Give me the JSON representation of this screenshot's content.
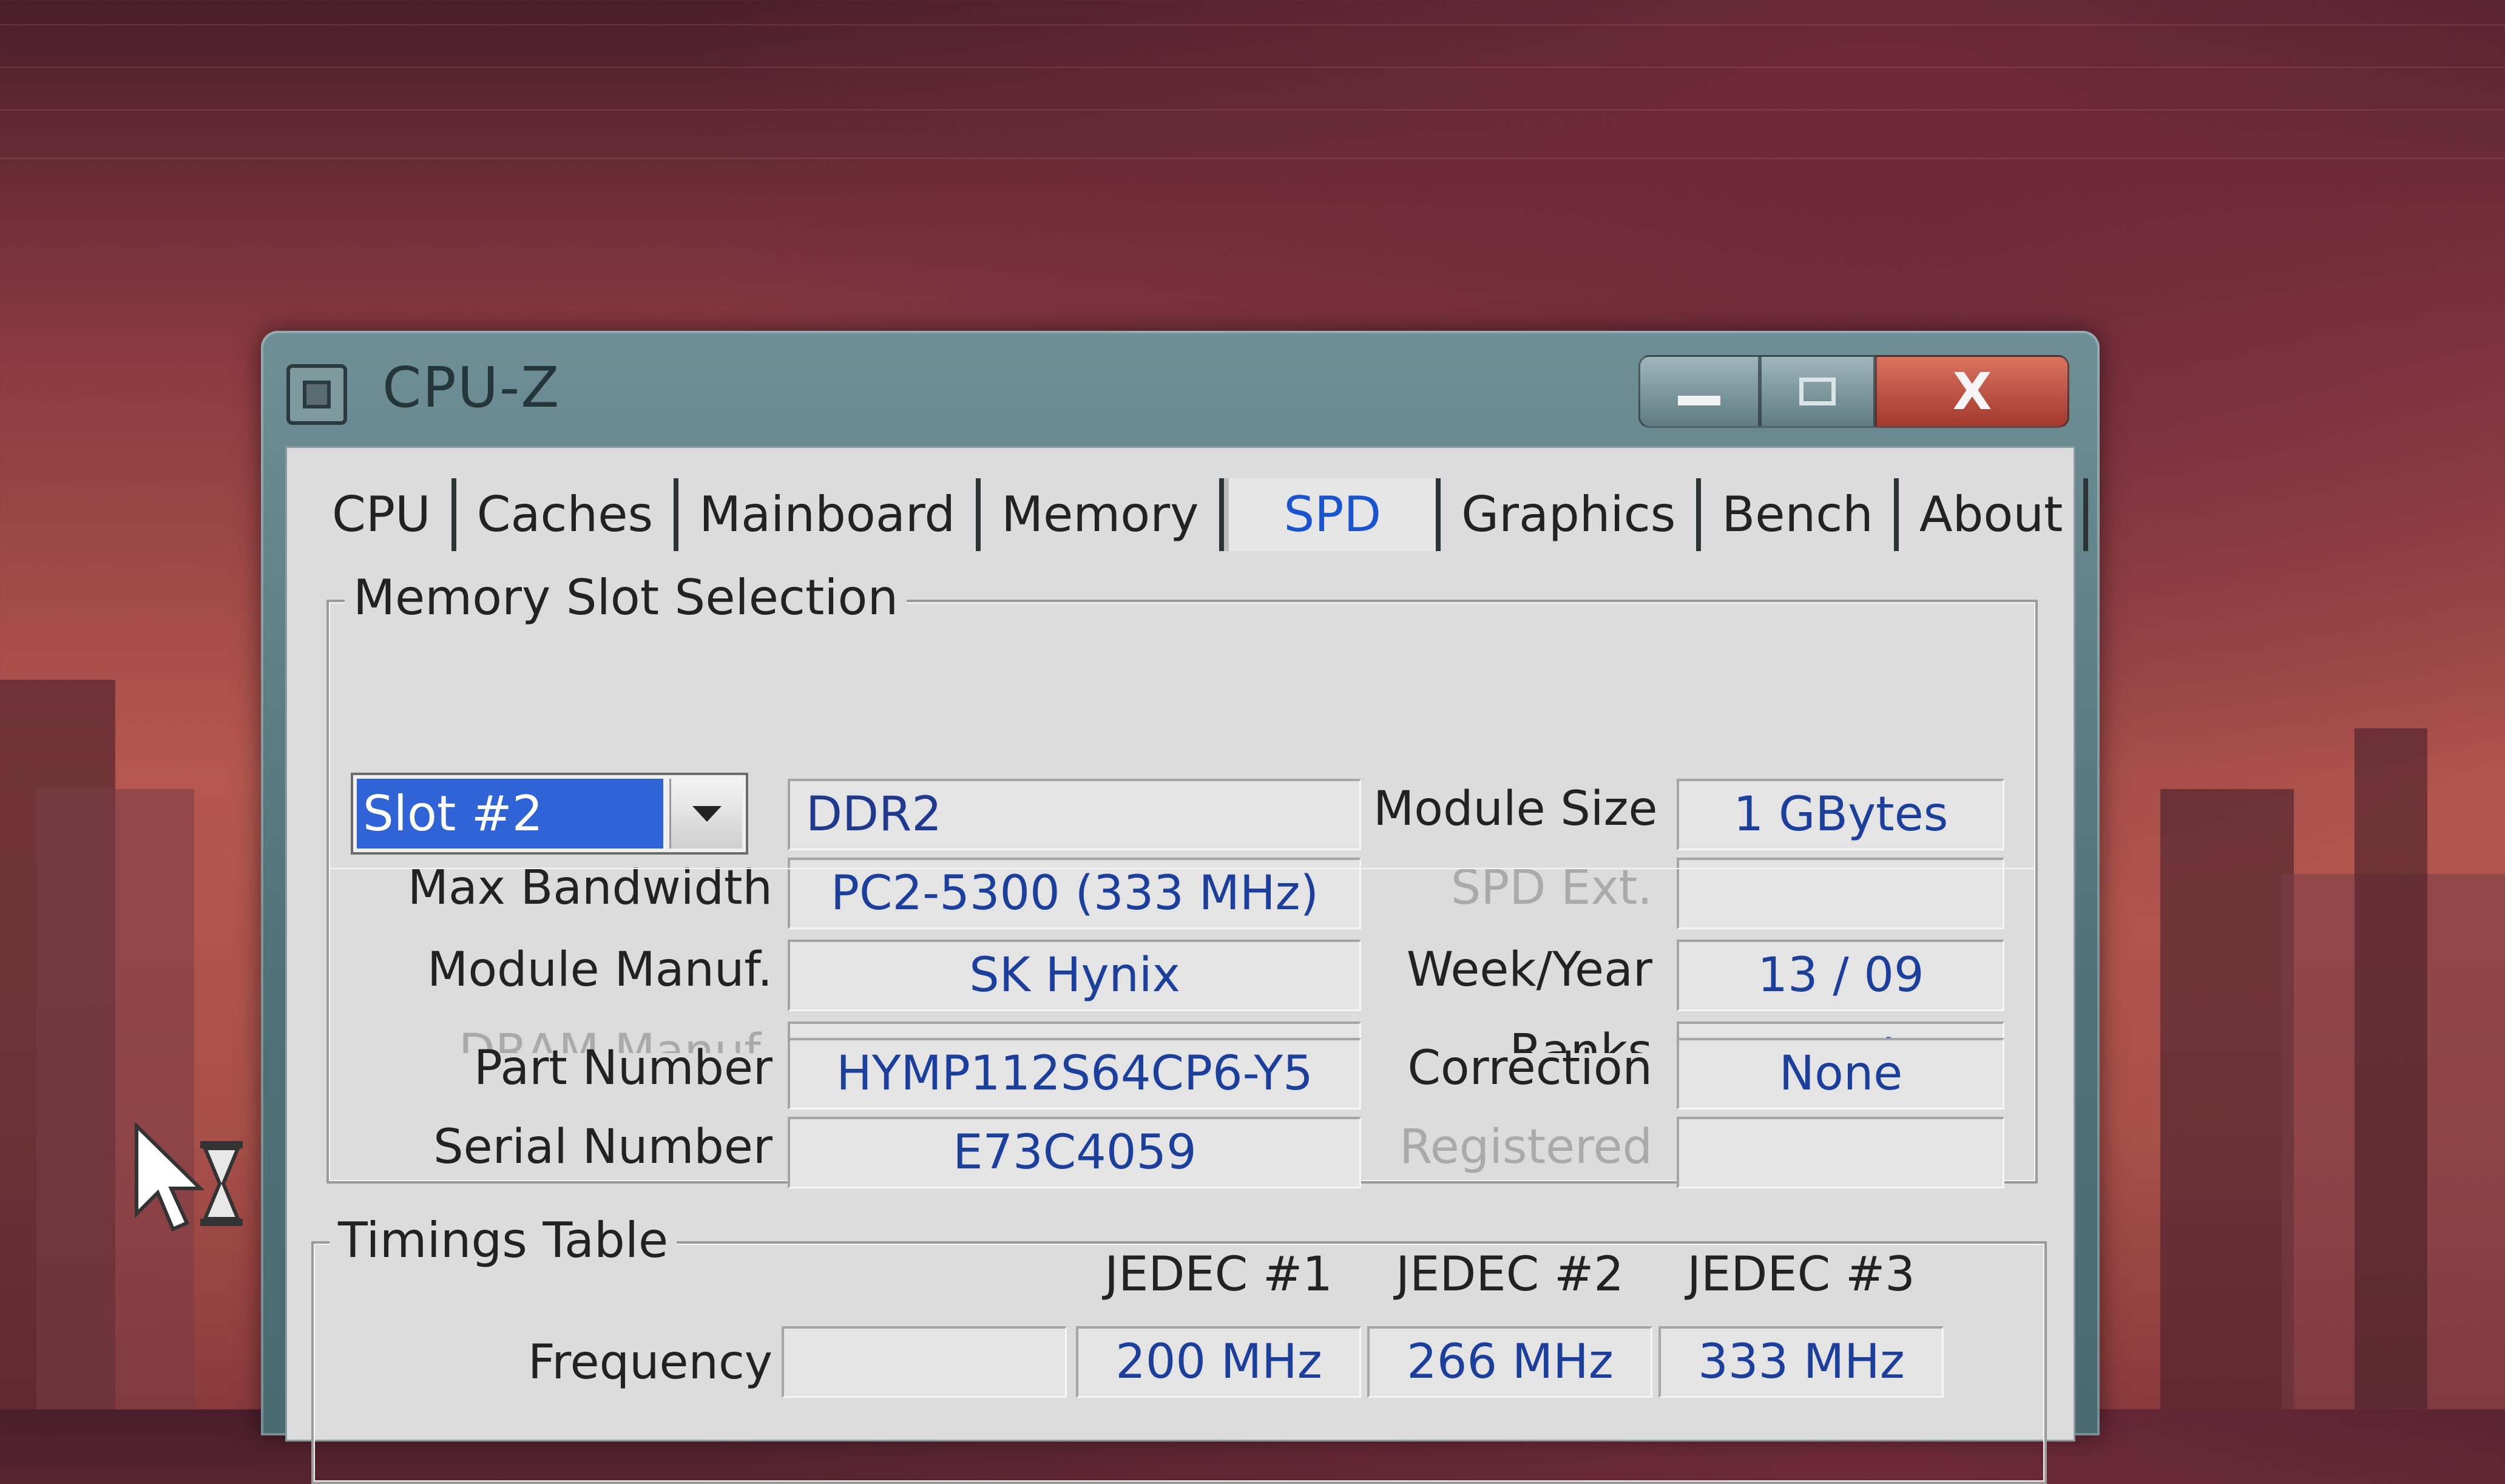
{
  "window": {
    "title": "CPU-Z",
    "controls": {
      "close_glyph": "X"
    }
  },
  "tabs": [
    {
      "label": "CPU"
    },
    {
      "label": "Caches"
    },
    {
      "label": "Mainboard"
    },
    {
      "label": "Memory"
    },
    {
      "label": "SPD",
      "active": true
    },
    {
      "label": "Graphics"
    },
    {
      "label": "Bench"
    },
    {
      "label": "About"
    }
  ],
  "slot_selection": {
    "group_label": "Memory Slot Selection",
    "selected_slot": "Slot #2",
    "memory_type": "DDR2",
    "left_fields": [
      {
        "label": "Max Bandwidth",
        "value": "PC2-5300 (333 MHz)",
        "enabled": true
      },
      {
        "label": "Module Manuf.",
        "value": "SK Hynix",
        "enabled": true
      },
      {
        "label": "DRAM Manuf.",
        "value": "",
        "enabled": false
      },
      {
        "label": "Part Number",
        "value": "HYMP112S64CP6-Y5",
        "enabled": true
      },
      {
        "label": "Serial Number",
        "value": "E73C4059",
        "enabled": true
      }
    ],
    "right_fields": [
      {
        "label": "Module Size",
        "value": "1 GBytes",
        "enabled": true
      },
      {
        "label": "SPD Ext.",
        "value": "",
        "enabled": false
      },
      {
        "label": "Week/Year",
        "value": "13 / 09",
        "enabled": true
      },
      {
        "label": "Ranks",
        "value": "Dual",
        "enabled": true
      },
      {
        "label": "Correction",
        "value": "None",
        "enabled": true
      },
      {
        "label": "Registered",
        "value": "",
        "enabled": false
      }
    ]
  },
  "timings": {
    "group_label": "Timings Table",
    "columns": [
      "JEDEC #1",
      "JEDEC #2",
      "JEDEC #3"
    ],
    "rows": [
      {
        "label": "Frequency",
        "values": [
          "200 MHz",
          "266 MHz",
          "333 MHz"
        ]
      }
    ]
  },
  "colors": {
    "accent_tab": "#1a55d0",
    "value_text": "#1c3f9c",
    "selection_bg": "#2f63d6",
    "close_button": "#a23a2e"
  },
  "icons": {
    "app": "cpu-chip-icon",
    "cursor": "busy-cursor-icon"
  }
}
